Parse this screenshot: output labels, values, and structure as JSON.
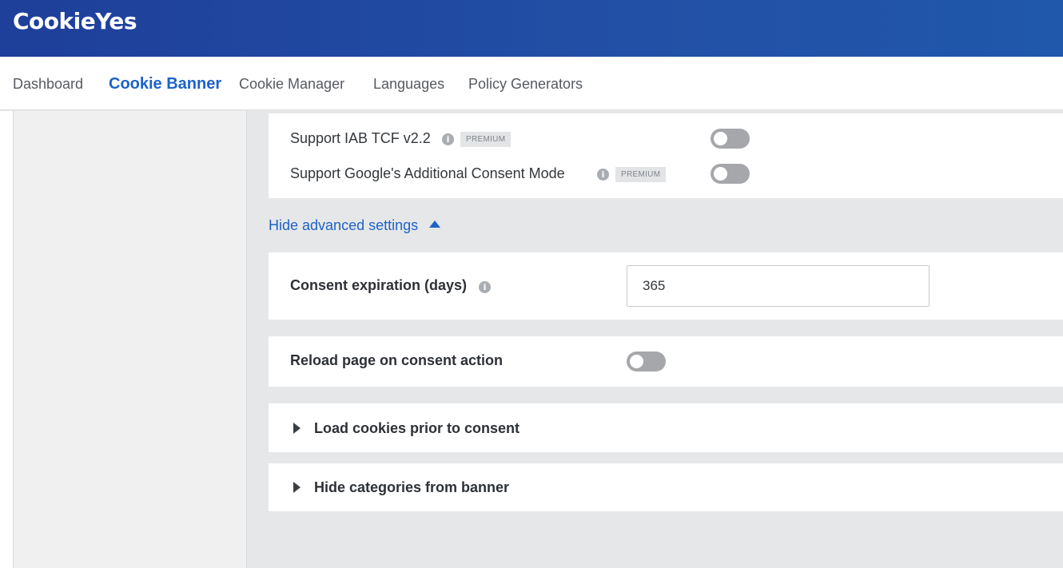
{
  "brand": {
    "logo_text": "CookieYes"
  },
  "nav": {
    "items": [
      {
        "label": "Dashboard"
      },
      {
        "label": "Cookie Banner",
        "active": true
      },
      {
        "label": "Cookie Manager"
      },
      {
        "label": "Languages"
      },
      {
        "label": "Policy Generators"
      }
    ]
  },
  "iab": {
    "tcf_label": "Support IAB TCF v2.2",
    "tcf_badge": "PREMIUM",
    "tcf_enabled": false,
    "acm_label": "Support Google's Additional Consent Mode",
    "acm_badge": "PREMIUM",
    "acm_enabled": false
  },
  "advanced": {
    "toggle_label": "Hide advanced settings"
  },
  "consent_expiration": {
    "label": "Consent expiration (days)",
    "value": "365"
  },
  "reload": {
    "label": "Reload page on consent action",
    "enabled": false
  },
  "sections": {
    "load_cookies": "Load cookies prior to consent",
    "hide_categories": "Hide categories from banner"
  },
  "info_glyph": "i",
  "colors": {
    "brand_blue": "#2250a6",
    "link_blue": "#1d63c8",
    "toggle_off": "#a5a7ab"
  }
}
